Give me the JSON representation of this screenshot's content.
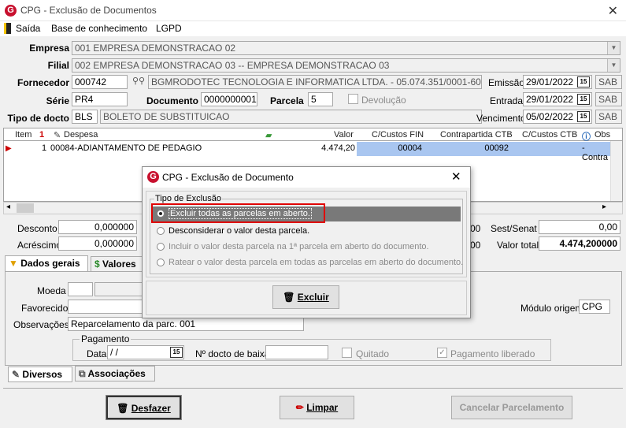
{
  "window": {
    "title": "CPG - Exclusão de Documentos",
    "close": "✕"
  },
  "menu": [
    "Saída",
    "Base de conhecimento",
    "LGPD"
  ],
  "form": {
    "empresa_label": "Empresa",
    "empresa": "001 EMPRESA DEMONSTRACAO 02",
    "filial_label": "Filial",
    "filial": "002 EMPRESA DEMONSTRACAO 03 -- EMPRESA DEMONSTRACAO 03",
    "fornecedor_label": "Fornecedor",
    "fornecedor_code": "000742",
    "fornecedor_name": "BGMRODOTEC TECNOLOGIA E INFORMATICA LTDA. - 05.074.351/0001-60",
    "emissao_label": "Emissão",
    "emissao": "29/01/2022",
    "serie_label": "Série",
    "serie": "PR4",
    "documento_label": "Documento",
    "documento": "0000000001",
    "parcela_label": "Parcela",
    "parcela": "5",
    "devolucao_label": "Devolução",
    "entrada_label": "Entrada",
    "entrada": "29/01/2022",
    "tipo_label": "Tipo de docto",
    "tipo_code": "BLS",
    "tipo_name": "BOLETO DE SUBSTITUICAO",
    "vencimento_label": "Vencimento",
    "vencimento": "05/02/2022",
    "sab": "SAB",
    "cal": "15"
  },
  "grid": {
    "headers": [
      "Item",
      "Despesa",
      "Valor",
      "C/Custos FIN",
      "Contrapartida CTB",
      "C/Custos CTB",
      "Obs"
    ],
    "sort_num": "1",
    "row": {
      "item": "1",
      "despesa": "00084-ADIANTAMENTO DE PEDAGIO",
      "valor": "4.474,20",
      "ccfin": "00004",
      "contrap": "00092",
      "ccctb": "",
      "obs": "- Contra"
    }
  },
  "totals": {
    "desconto_label": "Desconto",
    "desconto": "0,000000",
    "acrescimo_label": "Acréscimo",
    "acrescimo": "0,000000",
    "sest_label": "Sest/Senat",
    "sest": "0,00",
    "valor_total_label": "Valor total",
    "valor_total": "4.474,200000",
    "mid1": "00",
    "mid2": "00"
  },
  "tabs": {
    "dados_gerais": "Dados gerais",
    "valores": "Valores"
  },
  "details": {
    "moeda_label": "Moeda",
    "favorecido_label": "Favorecido",
    "obs_label": "Observações",
    "obs": "Reparcelamento da parc. 001",
    "modulo_label": "Módulo origem",
    "modulo": "CPG",
    "pagamento_label": "Pagamento",
    "data_label": "Data",
    "data": " /  /",
    "ndocto_label": "Nº docto de baixa",
    "quitado_label": "Quitado",
    "pag_lib_label": "Pagamento liberado"
  },
  "bottom_tabs": {
    "diversos": "Diversos",
    "associacoes": "Associações"
  },
  "buttons": {
    "desfazer": "Desfazer",
    "limpar": "Limpar",
    "cancelar": "Cancelar Parcelamento"
  },
  "dialog": {
    "title": "CPG - Exclusão de Documento",
    "close": "✕",
    "group": "Tipo de Exclusão",
    "opt1": "Excluir todas as parcelas em aberto.",
    "opt2": "Desconsiderar o valor desta  parcela.",
    "opt3": "Incluir o valor desta parcela na 1ª parcela em aberto do documento.",
    "opt4": "Ratear o valor desta parcela em todas as parcelas em aberto do documento.",
    "excluir": "Excluir"
  }
}
